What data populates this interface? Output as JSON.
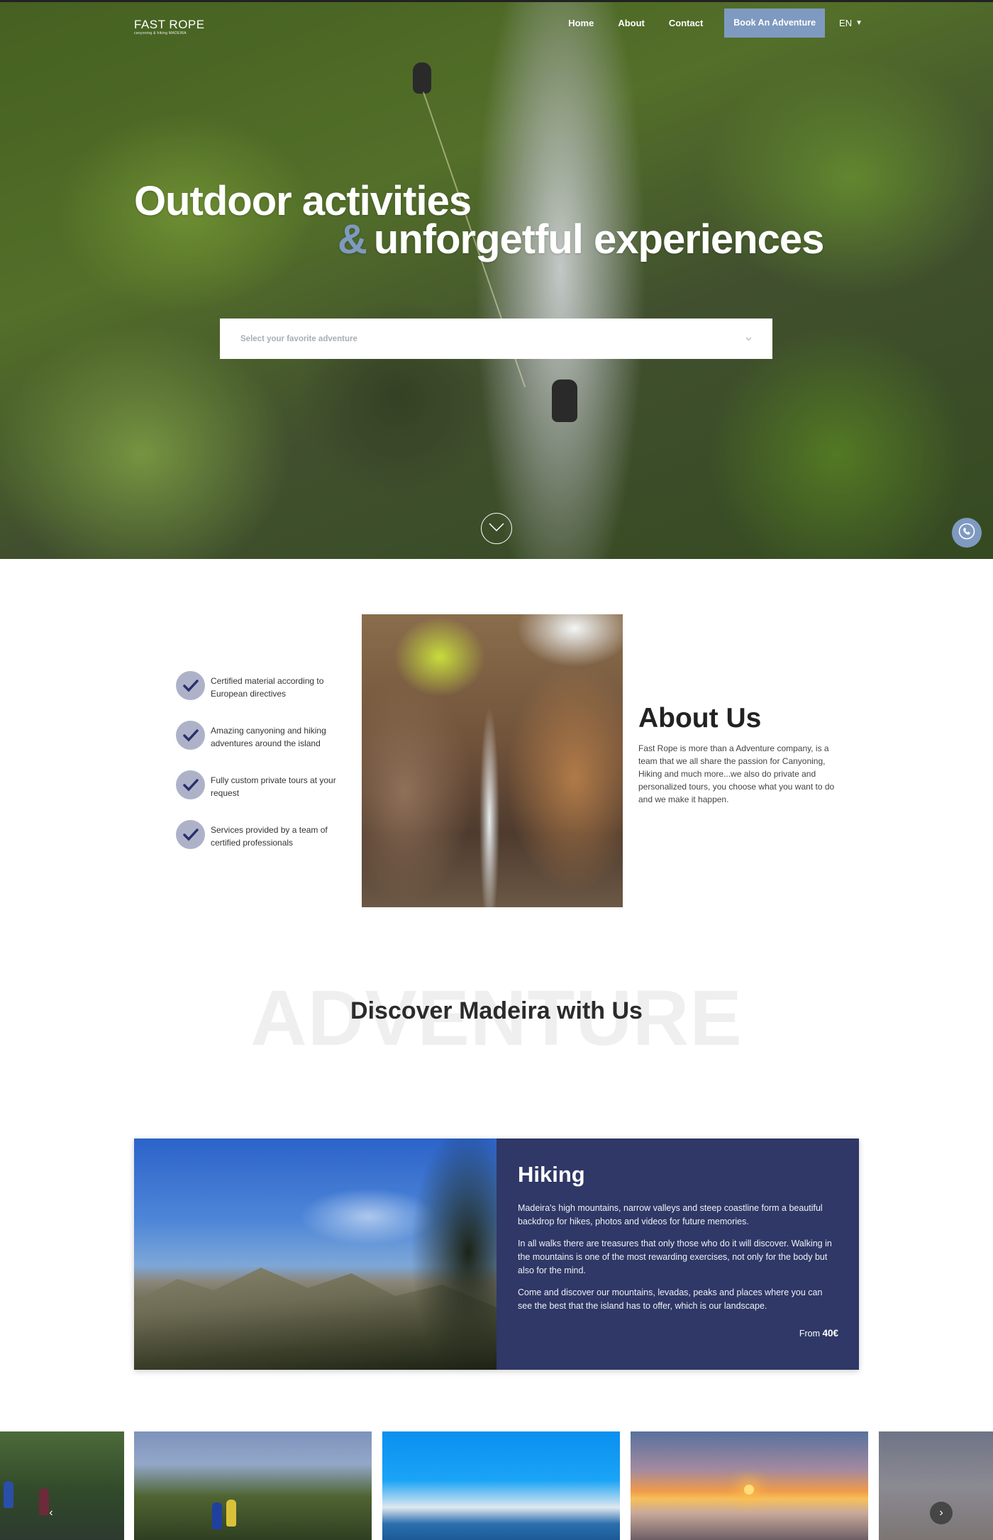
{
  "header": {
    "logo_main": "FAST ROPE",
    "logo_sub": "canyoning & hiking MADEIRA",
    "nav": [
      "Home",
      "About",
      "Contact"
    ],
    "book_label": "Book An Adventure",
    "language": "EN"
  },
  "hero": {
    "title_line1": "Outdoor activities",
    "title_amp": "&",
    "title_line2": "unforgetful experiences",
    "select_placeholder": "Select your favorite adventure"
  },
  "about": {
    "features": [
      "Certified material according to European directives",
      "Amazing canyoning and hiking adventures around the island",
      "Fully custom private tours at your request",
      "Services provided by a team of certified professionals"
    ],
    "title": "About Us",
    "text": "Fast Rope is more than a Adventure company, is a team that we all share the passion for Canyoning, Hiking and much more...we also do private and personalized tours, you choose what you want to do and we make it happen."
  },
  "discover": {
    "background_word": "ADVENTURE",
    "title": "Discover Madeira with Us"
  },
  "activity_card": {
    "title": "Hiking",
    "paragraphs": [
      "Madeira's high mountains, narrow valleys and steep coastline form a beautiful backdrop for hikes, photos and videos for future memories.",
      "In all walks there are treasures that only those who do it will discover. Walking in the mountains is one of the most rewarding exercises, not only for the body but also for the mind.",
      "Come and discover our mountains, levadas, peaks and places where you can see the best that the island has to offer, which is our landscape."
    ],
    "price_prefix": "From",
    "price": "40€"
  },
  "carousel": {
    "prev_icon": "‹",
    "next_icon": "›"
  },
  "colors": {
    "accent": "#7f9ac0",
    "card_background": "#2f3866",
    "check_circle": "#aeb2c9",
    "check_mark": "#2b2f6b"
  }
}
